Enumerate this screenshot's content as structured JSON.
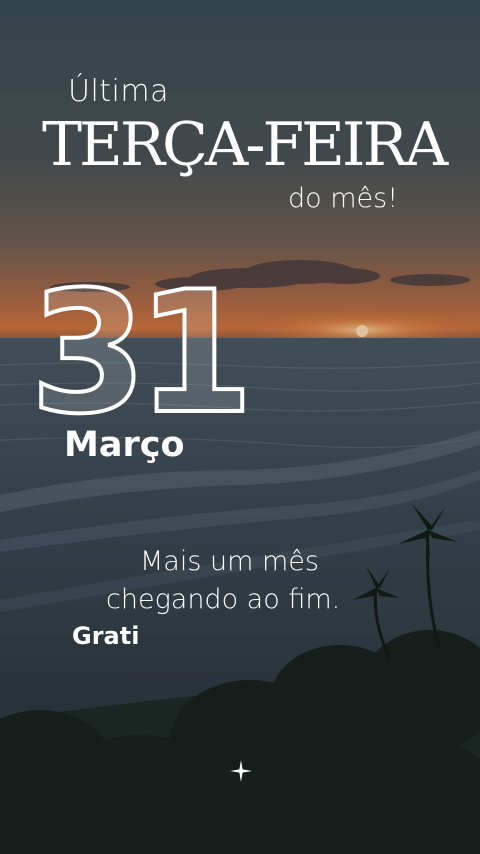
{
  "card": {
    "line1": "Última",
    "line2": "TERÇA-FEIRA",
    "line3": "do mês!",
    "day": "31",
    "month": "Março",
    "message_line1": "Mais um mês",
    "message_line2": "chegando ao fim.",
    "signoff": "Grati"
  },
  "colors": {
    "sky_top": "#3a4a52",
    "sky_glow": "#c9744a",
    "sun": "#ffd8a8",
    "sea": "#2c3a44",
    "text": "#ffffff"
  },
  "icons": [
    "sparkle-icon"
  ]
}
